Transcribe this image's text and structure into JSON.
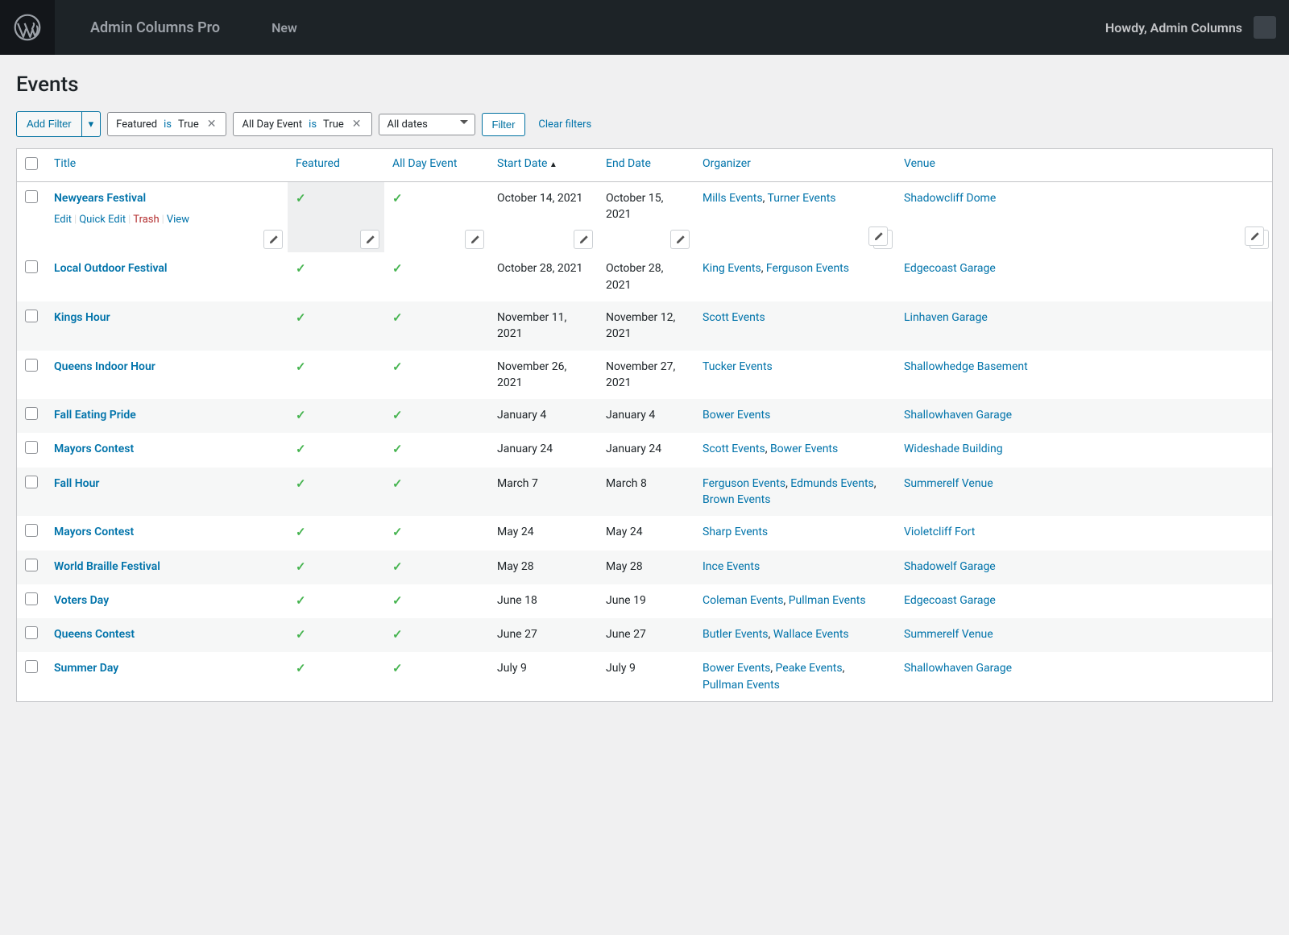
{
  "adminbar": {
    "site_title": "Admin Columns Pro",
    "new_label": "New",
    "howdy": "Howdy,  Admin Columns"
  },
  "page": {
    "title": "Events"
  },
  "filters": {
    "add_filter": "Add Filter",
    "chips": [
      {
        "key": "Featured",
        "op": "is",
        "val": "True"
      },
      {
        "key": "All Day Event",
        "op": "is",
        "val": "True"
      }
    ],
    "dates_selected": "All dates",
    "filter_btn": "Filter",
    "clear": "Clear filters"
  },
  "columns": {
    "title": "Title",
    "featured": "Featured",
    "allday": "All Day Event",
    "start": "Start Date",
    "end": "End Date",
    "organizer": "Organizer",
    "venue": "Venue"
  },
  "row_actions": {
    "edit": "Edit",
    "quick": "Quick Edit",
    "trash": "Trash",
    "view": "View"
  },
  "rows": [
    {
      "title": "Newyears Festival",
      "start": "October 14, 2021",
      "end": "October 15, 2021",
      "organizers": [
        "Mills Events",
        "Turner Events"
      ],
      "venue": "Shadowcliff Dome",
      "hover": true
    },
    {
      "title": "Local Outdoor Festival",
      "start": "October 28, 2021",
      "end": "October 28, 2021",
      "organizers": [
        "King Events",
        "Ferguson Events"
      ],
      "venue": "Edgecoast Garage"
    },
    {
      "title": "Kings Hour",
      "start": "November 11, 2021",
      "end": "November 12, 2021",
      "organizers": [
        "Scott Events"
      ],
      "venue": "Linhaven Garage"
    },
    {
      "title": "Queens Indoor Hour",
      "start": "November 26, 2021",
      "end": "November 27, 2021",
      "organizers": [
        "Tucker Events"
      ],
      "venue": "Shallowhedge Basement"
    },
    {
      "title": "Fall Eating Pride",
      "start": "January 4",
      "end": "January 4",
      "organizers": [
        "Bower Events"
      ],
      "venue": "Shallowhaven Garage"
    },
    {
      "title": "Mayors Contest",
      "start": "January 24",
      "end": "January 24",
      "organizers": [
        "Scott Events",
        "Bower Events"
      ],
      "venue": "Wideshade Building"
    },
    {
      "title": "Fall Hour",
      "start": "March 7",
      "end": "March 8",
      "organizers": [
        "Ferguson Events",
        "Edmunds Events",
        "Brown Events"
      ],
      "venue": "Summerelf Venue"
    },
    {
      "title": "Mayors Contest",
      "start": "May 24",
      "end": "May 24",
      "organizers": [
        "Sharp Events"
      ],
      "venue": "Violetcliff Fort"
    },
    {
      "title": "World Braille Festival",
      "start": "May 28",
      "end": "May 28",
      "organizers": [
        "Ince Events"
      ],
      "venue": "Shadowelf Garage"
    },
    {
      "title": "Voters Day",
      "start": "June 18",
      "end": "June 19",
      "organizers": [
        "Coleman Events",
        "Pullman Events"
      ],
      "venue": "Edgecoast Garage"
    },
    {
      "title": "Queens Contest",
      "start": "June 27",
      "end": "June 27",
      "organizers": [
        "Butler Events",
        "Wallace Events"
      ],
      "venue": "Summerelf Venue"
    },
    {
      "title": "Summer Day",
      "start": "July 9",
      "end": "July 9",
      "organizers": [
        "Bower Events",
        "Peake Events",
        "Pullman Events"
      ],
      "venue": "Shallowhaven Garage"
    }
  ]
}
